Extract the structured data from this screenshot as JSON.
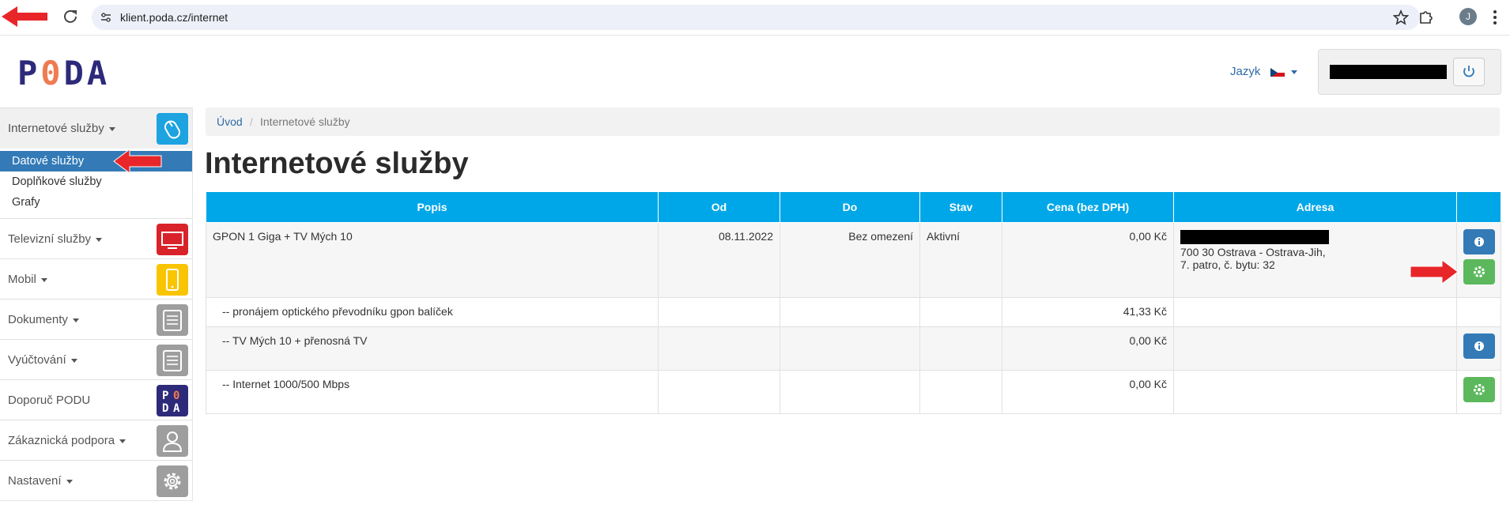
{
  "browser": {
    "url": "klient.poda.cz/internet",
    "profile_initial": "J"
  },
  "header": {
    "logo_p": "P",
    "logo_zero": "0",
    "logo_rest": "DA",
    "language_label": "Jazyk"
  },
  "sidebar": {
    "items": [
      {
        "label": "Internetové služby"
      },
      {
        "label": "Televizní služby"
      },
      {
        "label": "Mobil"
      },
      {
        "label": "Dokumenty"
      },
      {
        "label": "Vyúčtování"
      },
      {
        "label": "Doporuč PODU"
      },
      {
        "label": "Zákaznická podpora"
      },
      {
        "label": "Nastavení"
      }
    ],
    "submenu": [
      {
        "label": "Datové služby"
      },
      {
        "label": "Doplňkové služby"
      },
      {
        "label": "Grafy"
      }
    ],
    "tile_colors": {
      "internet": "#1ca3e0",
      "tv": "#d9232a",
      "mobile": "#f9c400",
      "gray": "#9e9e9e",
      "poda": "#2e2a7a"
    }
  },
  "breadcrumb": {
    "home": "Úvod",
    "separator": "/",
    "current": "Internetové služby"
  },
  "page": {
    "title": "Internetové služby"
  },
  "table": {
    "headers": [
      "Popis",
      "Od",
      "Do",
      "Stav",
      "Cena (bez DPH)",
      "Adresa",
      ""
    ],
    "rows": [
      {
        "popis": "GPON 1 Giga + TV Mých 10",
        "od": "08.11.2022",
        "do": "Bez omezení",
        "stav": "Aktivní",
        "cena": "0,00 Kč",
        "adresa_line1": "700 30 Ostrava - Ostrava-Jih,",
        "adresa_line2": "7. patro, č. bytu: 32"
      },
      {
        "popis": "-- pronájem optického převodníku gpon balíček",
        "cena": "41,33 Kč"
      },
      {
        "popis": "-- TV Mých 10 + přenosná TV",
        "cena": "0,00 Kč"
      },
      {
        "popis": "-- Internet 1000/500 Mbps",
        "cena": "0,00 Kč"
      }
    ]
  },
  "colors": {
    "table_header": "#00a7e8",
    "link": "#2f6aa8",
    "selected": "#337ab7",
    "info_button": "#337ab7",
    "settings_button": "#5cb85c",
    "annotation_arrow": "#e8262a"
  }
}
